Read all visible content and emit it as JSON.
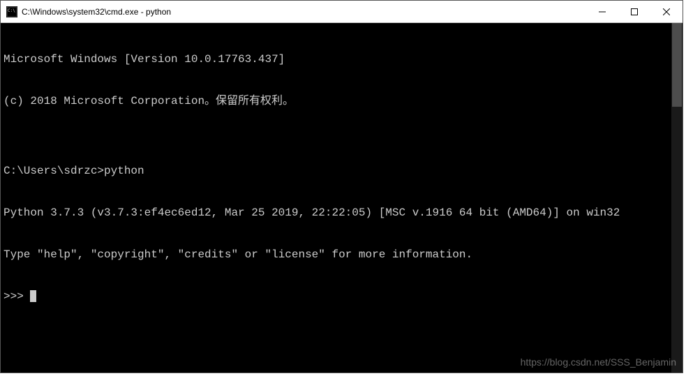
{
  "titlebar": {
    "title": "C:\\Windows\\system32\\cmd.exe - python"
  },
  "terminal": {
    "lines": [
      "Microsoft Windows [Version 10.0.17763.437]",
      "(c) 2018 Microsoft Corporation。保留所有权利。",
      "",
      "C:\\Users\\sdrzc>python",
      "Python 3.7.3 (v3.7.3:ef4ec6ed12, Mar 25 2019, 22:22:05) [MSC v.1916 64 bit (AMD64)] on win32",
      "Type \"help\", \"copyright\", \"credits\" or \"license\" for more information."
    ],
    "prompt": ">>> "
  },
  "watermark": "https://blog.csdn.net/SSS_Benjamin"
}
